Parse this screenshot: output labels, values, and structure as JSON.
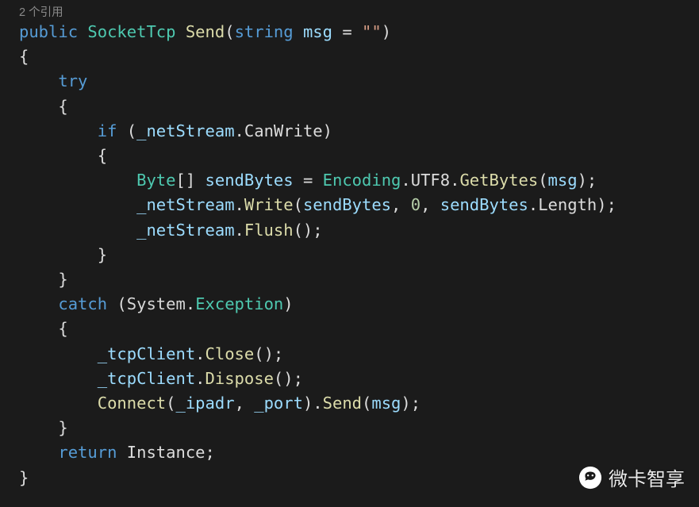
{
  "codelens": "2 个引用",
  "watermark": "微卡智享",
  "code": {
    "l1": {
      "kw_public": "public",
      "type": "SocketTcp",
      "mtd": "Send",
      "p_o": "(",
      "kw_string": "string",
      "sp": " ",
      "prm": "msg",
      "eq": " = ",
      "str": "\"\"",
      "p_c": ")"
    },
    "l2": {
      "brace": "{"
    },
    "l3": {
      "indent": "    ",
      "kw": "try"
    },
    "l4": {
      "indent": "    ",
      "brace": "{"
    },
    "l5": {
      "indent": "        ",
      "kw": "if",
      "sp": " (",
      "prm": "_netStream",
      "dot": ".",
      "prop": "CanWrite",
      "cp": ")"
    },
    "l6": {
      "indent": "        ",
      "brace": "{"
    },
    "l7": {
      "indent": "            ",
      "type": "Byte",
      "arr": "[] ",
      "prm": "sendBytes",
      "eq": " = ",
      "type2": "Encoding",
      "dot1": ".",
      "prop": "UTF8",
      "dot2": ".",
      "mtd": "GetBytes",
      "op": "(",
      "arg": "msg",
      "cp": ");"
    },
    "l8": {
      "indent": "            ",
      "prm": "_netStream",
      "dot": ".",
      "mtd": "Write",
      "op": "(",
      "a1": "sendBytes",
      "c1": ", ",
      "num": "0",
      "c2": ", ",
      "a2": "sendBytes",
      "dot2": ".",
      "prop": "Length",
      "cp": ");"
    },
    "l9": {
      "indent": "            ",
      "prm": "_netStream",
      "dot": ".",
      "mtd": "Flush",
      "op": "();"
    },
    "l10": {
      "indent": "        ",
      "brace": "}"
    },
    "l11": {
      "indent": "    ",
      "brace": "}"
    },
    "l12": {
      "indent": "    ",
      "kw": "catch",
      "sp": " (",
      "ns": "System",
      "dot": ".",
      "type": "Exception",
      "cp": ")"
    },
    "l13": {
      "indent": "    ",
      "brace": "{"
    },
    "l14": {
      "indent": "        ",
      "prm": "_tcpClient",
      "dot": ".",
      "mtd": "Close",
      "op": "();"
    },
    "l15": {
      "indent": "        ",
      "prm": "_tcpClient",
      "dot": ".",
      "mtd": "Dispose",
      "op": "();"
    },
    "l16": {
      "indent": "        ",
      "mtd": "Connect",
      "op": "(",
      "a1": "_ipadr",
      "c1": ", ",
      "a2": "_port",
      "cp": ").",
      "mtd2": "Send",
      "op2": "(",
      "a3": "msg",
      "cp2": ");"
    },
    "l17": {
      "indent": "    ",
      "brace": "}"
    },
    "l18": {
      "indent": "    ",
      "kw": "return",
      "sp": " ",
      "prop": "Instance",
      "sc": ";"
    },
    "l19": {
      "brace": "}"
    }
  }
}
